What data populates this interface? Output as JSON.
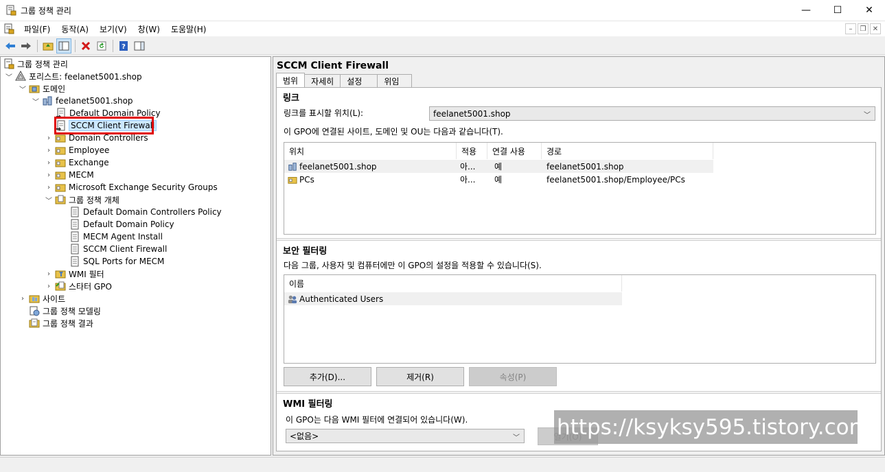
{
  "window": {
    "title": "그룹 정책 관리"
  },
  "menu": [
    "파일(F)",
    "동작(A)",
    "보기(V)",
    "창(W)",
    "도움말(H)"
  ],
  "tree": {
    "root": "그룹 정책 관리",
    "forest": "포리스트: feelanet5001.shop",
    "domains": "도메인",
    "domain": "feelanet5001.shop",
    "link1": "Default Domain Policy",
    "link2": "SCCM Client Firewall",
    "ou1": "Domain Controllers",
    "ou2": "Employee",
    "ou3": "Exchange",
    "ou4": "MECM",
    "ou5": "Microsoft Exchange Security Groups",
    "gpo_container": "그룹 정책 개체",
    "gpo1": "Default Domain Controllers Policy",
    "gpo2": "Default Domain Policy",
    "gpo3": "MECM Agent Install",
    "gpo4": "SCCM Client Firewall",
    "gpo5": "SQL Ports for MECM",
    "wmi": "WMI 필터",
    "starter": "스타터 GPO",
    "sites": "사이트",
    "modeling": "그룹 정책 모델링",
    "results": "그룹 정책 결과"
  },
  "right": {
    "title": "SCCM Client Firewall",
    "tabs": [
      "범위",
      "자세히",
      "설정",
      "위임"
    ],
    "links": {
      "heading": "링크",
      "location_label": "링크를 표시할 위치(L):",
      "location_value": "feelanet5001.shop",
      "desc": "이 GPO에 연결된 사이트, 도메인 및 OU는 다음과 같습니다(T).",
      "columns": [
        "위치",
        "적용",
        "연결 사용",
        "경로"
      ],
      "rows": [
        {
          "loc": "feelanet5001.shop",
          "enforced": "아...",
          "enabled": "예",
          "path": "feelanet5001.shop"
        },
        {
          "loc": "PCs",
          "enforced": "아...",
          "enabled": "예",
          "path": "feelanet5001.shop/Employee/PCs"
        }
      ]
    },
    "security": {
      "heading": "보안 필터링",
      "desc": "다음 그룹, 사용자 및 컴퓨터에만 이 GPO의 설정을 적용할 수 있습니다(S).",
      "column": "이름",
      "rows": [
        "Authenticated Users"
      ],
      "add": "추가(D)...",
      "remove": "제거(R)",
      "properties": "속성(P)"
    },
    "wmi": {
      "heading": "WMI 필터링",
      "desc": "이 GPO는 다음 WMI 필터에 연결되어 있습니다(W).",
      "value": "<없음>",
      "open": "열기(O)"
    }
  },
  "watermark": "https://ksyksy595.tistory.com"
}
